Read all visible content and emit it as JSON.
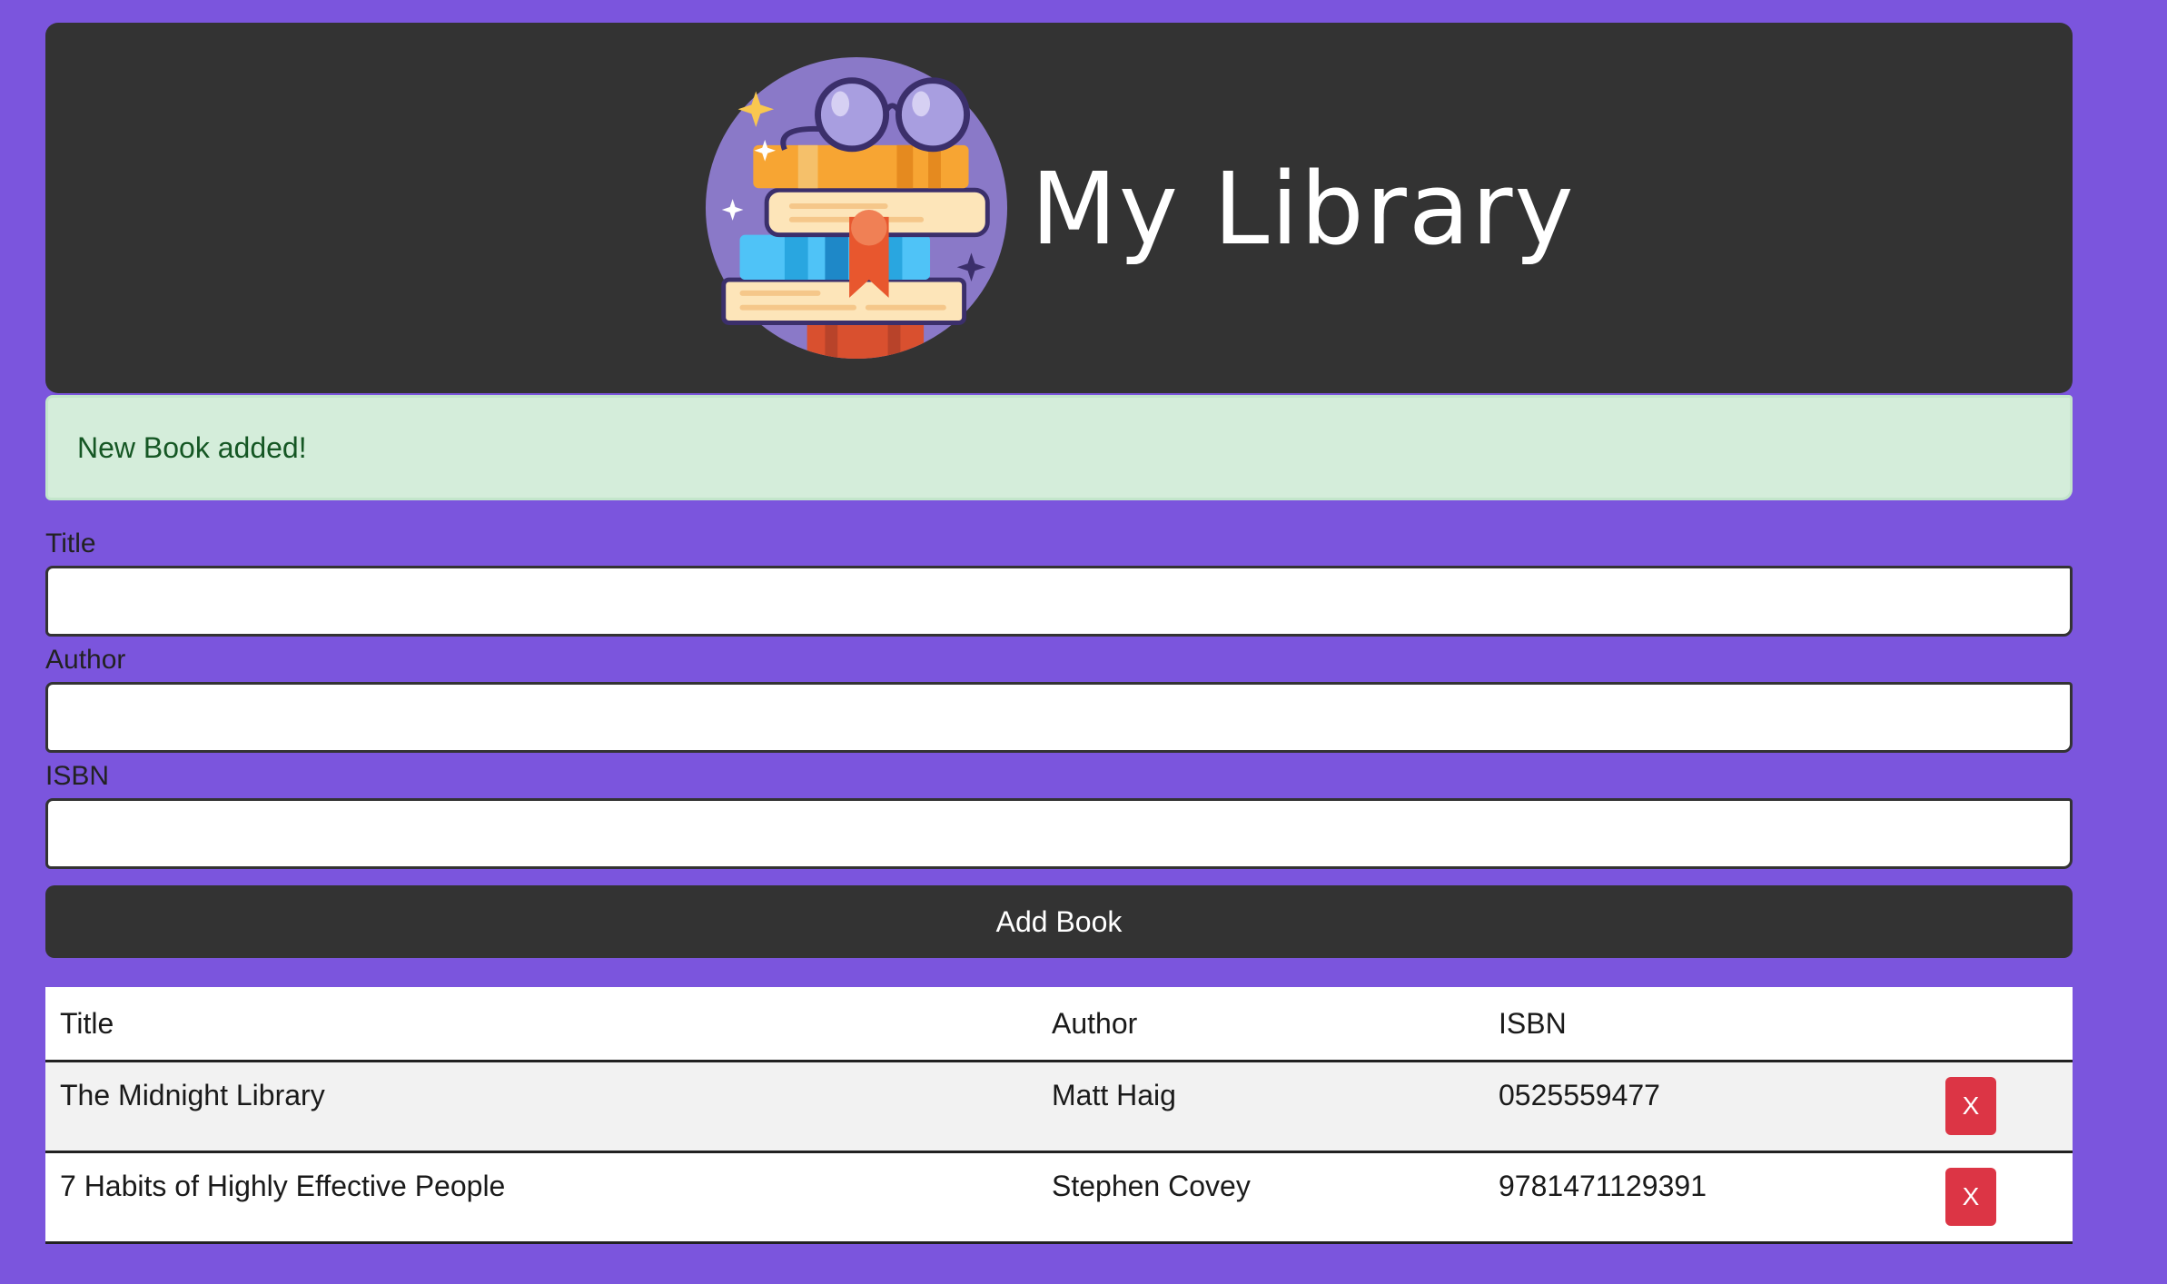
{
  "header": {
    "title": "My Library",
    "logo_icon": "stacked-books-with-glasses-icon"
  },
  "alert": {
    "message": "New Book added!"
  },
  "form": {
    "title_label": "Title",
    "title_value": "",
    "author_label": "Author",
    "author_value": "",
    "isbn_label": "ISBN",
    "isbn_value": "",
    "submit_label": "Add Book"
  },
  "table": {
    "headers": [
      "Title",
      "Author",
      "ISBN"
    ],
    "rows": [
      {
        "title": "The Midnight Library",
        "author": "Matt Haig",
        "isbn": "0525559477",
        "delete_label": "X"
      },
      {
        "title": "7 Habits of Highly Effective People",
        "author": "Stephen Covey",
        "isbn": "9781471129391",
        "delete_label": "X"
      }
    ]
  },
  "colors": {
    "page_background": "#7b55dd",
    "header_background": "#333333",
    "alert_background": "#d4edda",
    "alert_text": "#155724",
    "delete_button": "#dc3545"
  }
}
